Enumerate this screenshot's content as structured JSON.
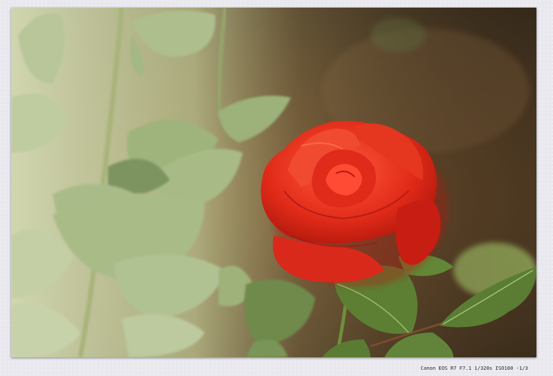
{
  "photo": {
    "subject": "red-rose",
    "exif_caption": "Canon EOS R7 F7.1 1/320s ISO100 -1/3"
  },
  "colors": {
    "frame": "#e8e8ee",
    "rose": "#e8321f",
    "leaf": "#9fb680",
    "background_dark": "#4a3520"
  }
}
